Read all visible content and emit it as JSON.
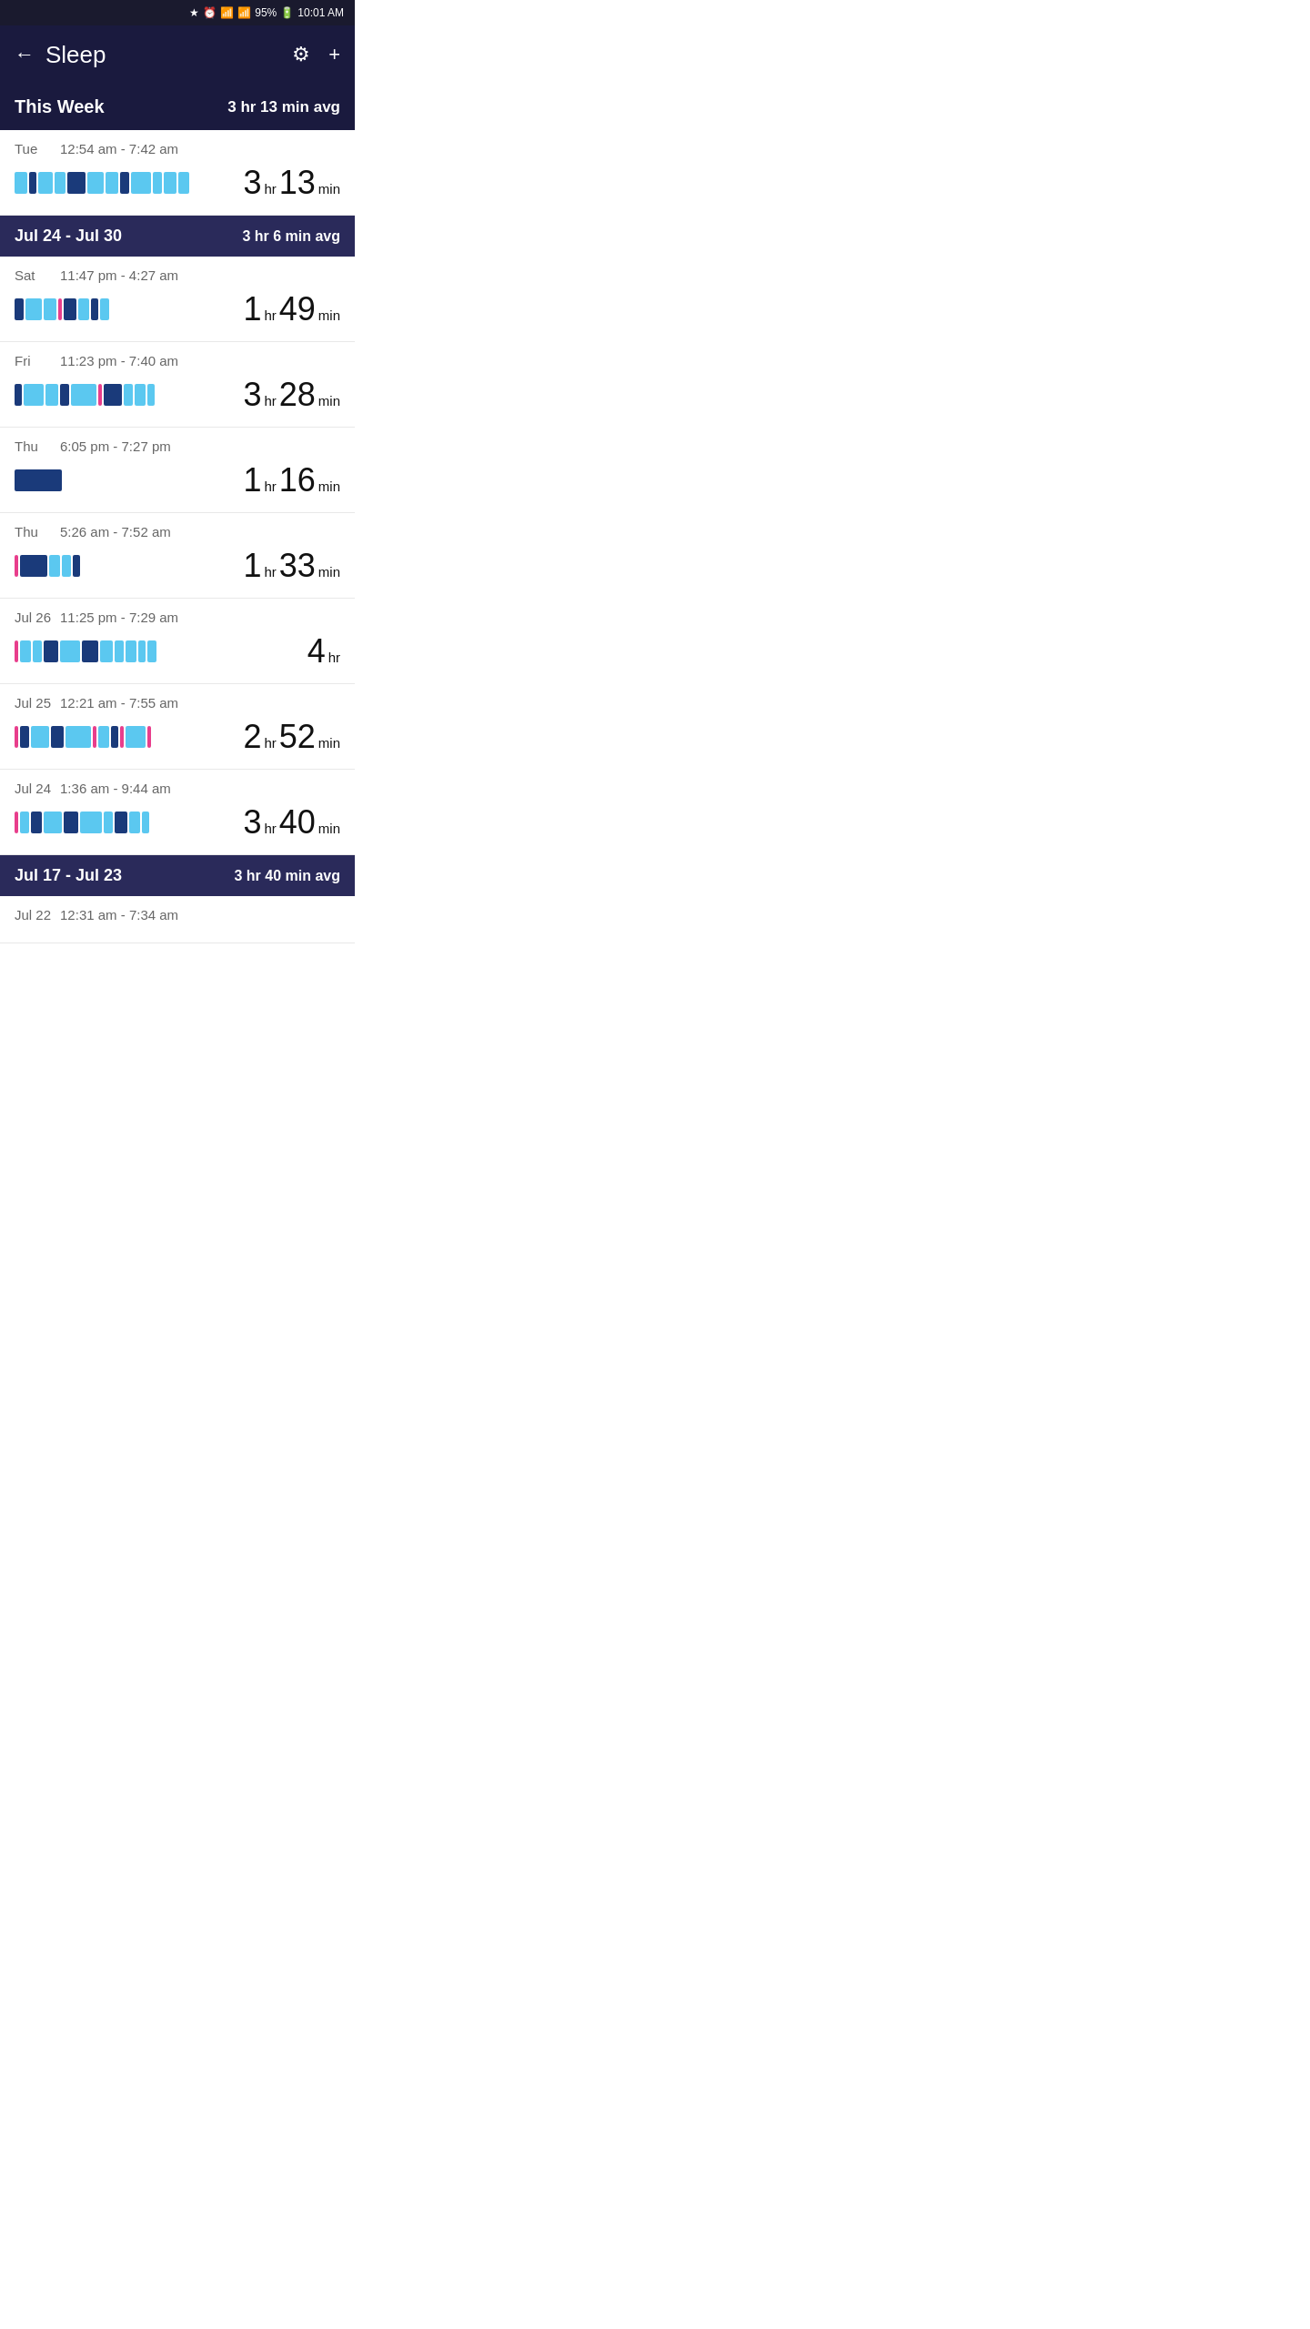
{
  "statusBar": {
    "battery": "95%",
    "time": "10:01 AM"
  },
  "header": {
    "title": "Sleep",
    "backLabel": "←",
    "settingsIcon": "⚙",
    "addIcon": "+"
  },
  "thisWeek": {
    "label": "This Week",
    "avg": "3 hr 13 min avg"
  },
  "currentWeekEntry": {
    "day": "Tue",
    "time": "12:54 am - 7:42 am",
    "durationLarge": "3",
    "durationUnit1": "hr",
    "durationSmall": "13",
    "durationUnit2": "min"
  },
  "week1": {
    "label": "Jul 24 - Jul 30",
    "avg": "3 hr 6 min avg",
    "entries": [
      {
        "day": "Sat",
        "time": "11:47 pm - 4:27 am",
        "durationLarge": "1",
        "durationUnit1": "hr",
        "durationSmall": "49",
        "durationUnit2": "min",
        "bars": "short"
      },
      {
        "day": "Fri",
        "time": "11:23 pm - 7:40 am",
        "durationLarge": "3",
        "durationUnit1": "hr",
        "durationSmall": "28",
        "durationUnit2": "min",
        "bars": "medium"
      },
      {
        "day": "Thu",
        "time": "6:05 pm - 7:27 pm",
        "durationLarge": "1",
        "durationUnit1": "hr",
        "durationSmall": "16",
        "durationUnit2": "min",
        "bars": "tiny"
      },
      {
        "day": "Thu",
        "time": "5:26 am - 7:52 am",
        "durationLarge": "1",
        "durationUnit1": "hr",
        "durationSmall": "33",
        "durationUnit2": "min",
        "bars": "small"
      },
      {
        "day": "Jul 26",
        "time": "11:25 pm - 7:29 am",
        "durationLarge": "4",
        "durationUnit1": "hr",
        "durationSmall": "",
        "durationUnit2": "",
        "bars": "long"
      },
      {
        "day": "Jul 25",
        "time": "12:21 am - 7:55 am",
        "durationLarge": "2",
        "durationUnit1": "hr",
        "durationSmall": "52",
        "durationUnit2": "min",
        "bars": "medium2"
      },
      {
        "day": "Jul 24",
        "time": "1:36 am - 9:44 am",
        "durationLarge": "3",
        "durationUnit1": "hr",
        "durationSmall": "40",
        "durationUnit2": "min",
        "bars": "medium3"
      }
    ]
  },
  "week2": {
    "label": "Jul 17 - Jul 23",
    "avg": "3 hr 40 min avg",
    "entries": [
      {
        "day": "Jul 22",
        "time": "12:31 am - 7:34 am",
        "durationLarge": "",
        "durationUnit1": "",
        "durationSmall": "",
        "durationUnit2": "",
        "bars": "medium"
      }
    ]
  }
}
